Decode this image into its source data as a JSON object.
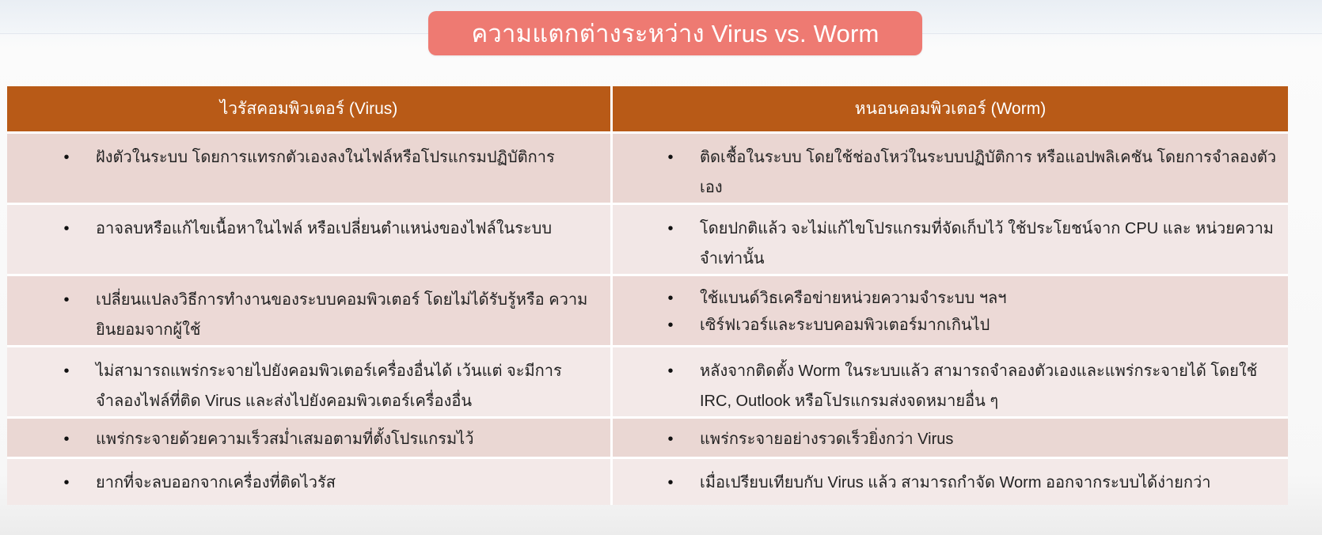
{
  "title": "ความแตกต่างระหว่าง Virus vs. Worm",
  "columns": {
    "left": "ไวรัสคอมพิวเตอร์ (Virus)",
    "right": "หนอนคอมพิวเตอร์ (Worm)"
  },
  "rows": [
    {
      "left": [
        "ฝังตัวในระบบ โดยการแทรกตัวเองลงในไฟล์หรือโปรแกรมปฏิบัติการ"
      ],
      "right": [
        "ติดเชื้อในระบบ โดยใช้ช่องโหว่ในระบบปฏิบัติการ หรือแอปพลิเคชัน โดยการจำลองตัวเอง"
      ]
    },
    {
      "left": [
        "อาจลบหรือแก้ไขเนื้อหาในไฟล์ หรือเปลี่ยนตำแหน่งของไฟล์ในระบบ"
      ],
      "right": [
        "โดยปกติแล้ว จะไม่แก้ไขโปรแกรมที่จัดเก็บไว้ ใช้ประโยชน์จาก CPU และ หน่วยความจำเท่านั้น"
      ]
    },
    {
      "left": [
        "เปลี่ยนแปลงวิธีการทำงานของระบบคอมพิวเตอร์ โดยไม่ได้รับรู้หรือ ความยินยอมจากผู้ใช้"
      ],
      "right": [
        "ใช้แบนด์วิธเครือข่ายหน่วยความจำระบบ ฯลฯ",
        "เซิร์ฟเวอร์และระบบคอมพิวเตอร์มากเกินไป"
      ]
    },
    {
      "left": [
        "ไม่สามารถแพร่กระจายไปยังคอมพิวเตอร์เครื่องอื่นได้ เว้นแต่ จะมีการจำลองไฟล์ที่ติด Virus และส่งไปยังคอมพิวเตอร์เครื่องอื่น"
      ],
      "right": [
        "หลังจากติดตั้ง Worm ในระบบแล้ว สามารถจำลองตัวเองและแพร่กระจายได้ โดยใช้ IRC, Outlook หรือโปรแกรมส่งจดหมายอื่น ๆ"
      ]
    },
    {
      "left": [
        "แพร่กระจายด้วยความเร็วสม่ำเสมอตามที่ตั้งโปรแกรมไว้"
      ],
      "right": [
        "แพร่กระจายอย่างรวดเร็วยิ่งกว่า Virus"
      ]
    },
    {
      "left": [
        "ยากที่จะลบออกจากเครื่องที่ติดไวรัส"
      ],
      "right": [
        "เมื่อเปรียบเทียบกับ Virus แล้ว สามารถกำจัด Worm ออกจากระบบได้ง่ายกว่า"
      ]
    }
  ],
  "bullet": "•",
  "colors": {
    "title_bg": "#ee7a72",
    "header_bg": "#b85a17",
    "row_dark": "#ead6d2",
    "row_light": "#f2e7e6"
  }
}
